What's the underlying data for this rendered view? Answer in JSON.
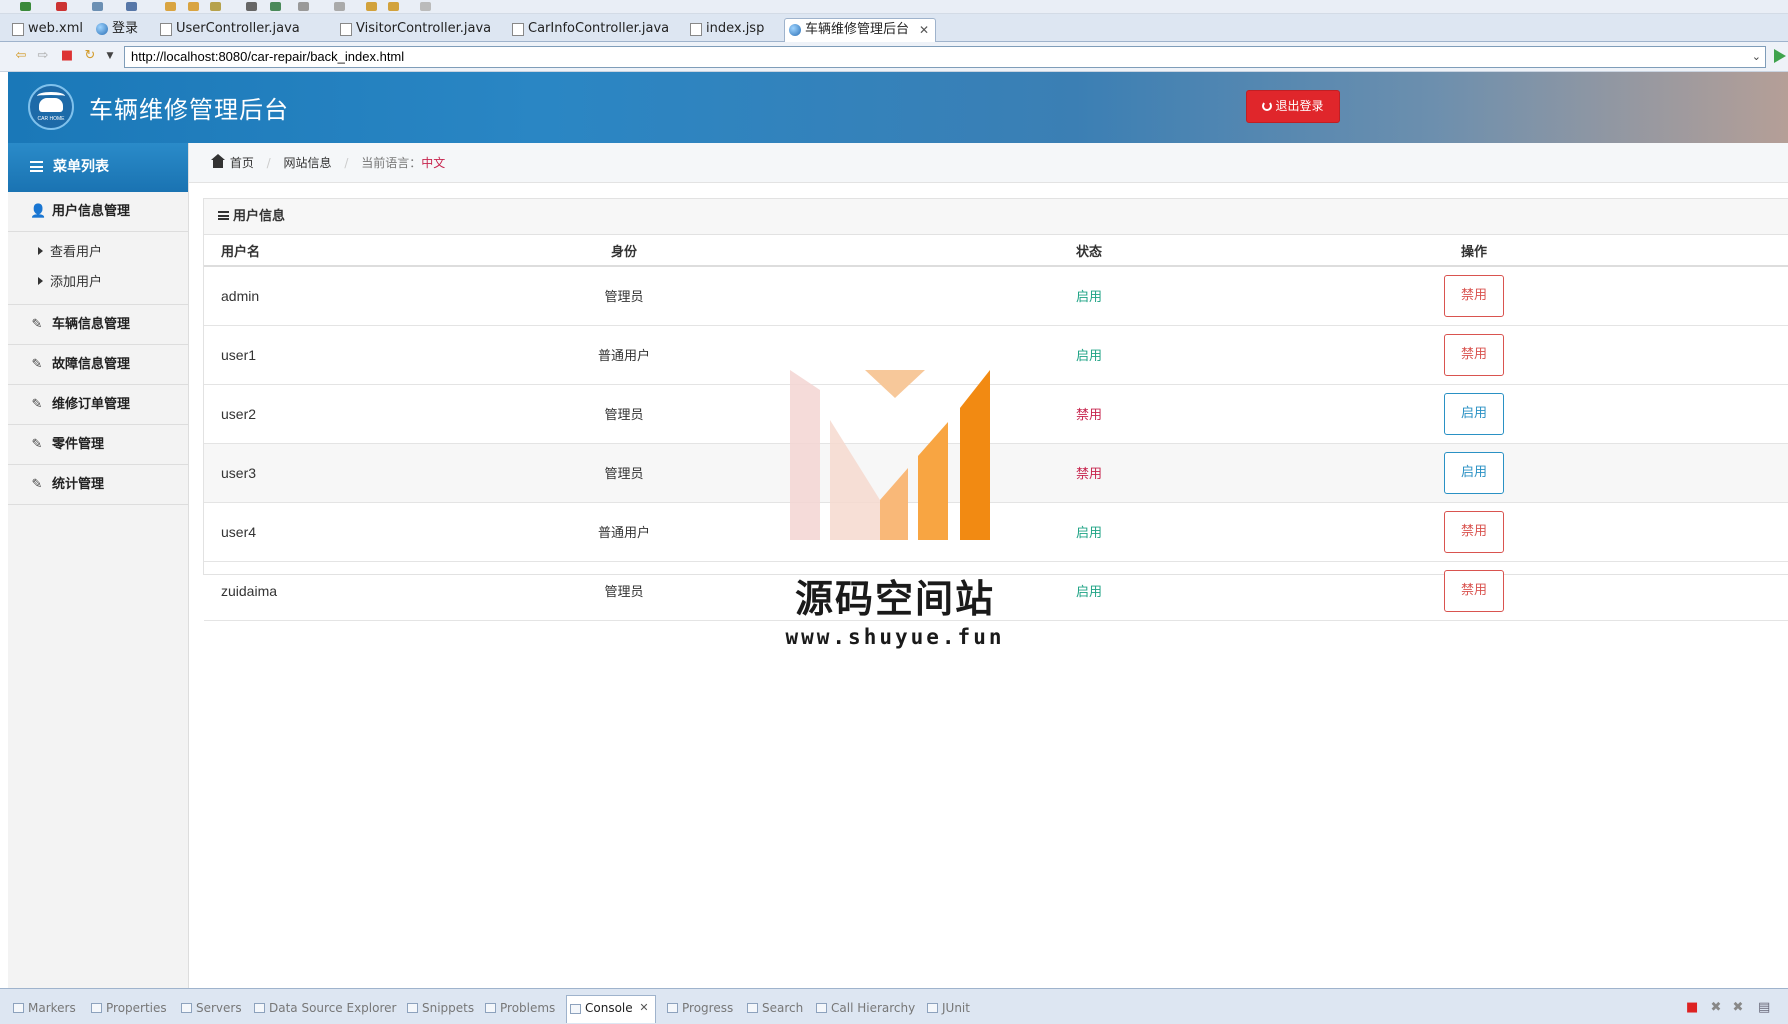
{
  "editor_tabs": [
    {
      "label": "web.xml",
      "type": "file"
    },
    {
      "label": "登录",
      "type": "web"
    },
    {
      "label": "UserController.java",
      "type": "file"
    },
    {
      "label": "VisitorController.java",
      "type": "file"
    },
    {
      "label": "CarInfoController.java",
      "type": "file"
    },
    {
      "label": "index.jsp",
      "type": "file"
    },
    {
      "label": "车辆维修管理后台",
      "type": "web",
      "active": true
    }
  ],
  "browser": {
    "url": "http://localhost:8080/car-repair/back_index.html"
  },
  "header": {
    "logo_text": "CAR HOME",
    "title": "车辆维修管理后台",
    "logout_label": "退出登录"
  },
  "sidebar": {
    "head": "菜单列表",
    "groups": [
      {
        "label": "用户信息管理",
        "icon": "user-icon",
        "sub": [
          "查看用户",
          "添加用户"
        ]
      },
      {
        "label": "车辆信息管理",
        "icon": "edit-icon"
      },
      {
        "label": "故障信息管理",
        "icon": "edit-icon"
      },
      {
        "label": "维修订单管理",
        "icon": "edit-icon"
      },
      {
        "label": "零件管理",
        "icon": "edit-icon"
      },
      {
        "label": "统计管理",
        "icon": "edit-icon"
      }
    ]
  },
  "breadcrumb": {
    "home": "首页",
    "site_info": "网站信息",
    "lang_label": "当前语言：",
    "lang_value": "中文"
  },
  "panel": {
    "title": "用户信息",
    "columns": [
      "用户名",
      "身份",
      "状态",
      "操作"
    ],
    "rows": [
      {
        "username": "admin",
        "role": "管理员",
        "status": "启用",
        "action": "禁用",
        "enabled": true
      },
      {
        "username": "user1",
        "role": "普通用户",
        "status": "启用",
        "action": "禁用",
        "enabled": true
      },
      {
        "username": "user2",
        "role": "管理员",
        "status": "禁用",
        "action": "启用",
        "enabled": false
      },
      {
        "username": "user3",
        "role": "管理员",
        "status": "禁用",
        "action": "启用",
        "enabled": false
      },
      {
        "username": "user4",
        "role": "普通用户",
        "status": "启用",
        "action": "禁用",
        "enabled": true
      },
      {
        "username": "zuidaima",
        "role": "管理员",
        "status": "启用",
        "action": "禁用",
        "enabled": true
      }
    ]
  },
  "watermark": {
    "title": "源码空间站",
    "url": "www.shuyue.fun"
  },
  "views": [
    {
      "label": "Markers"
    },
    {
      "label": "Properties"
    },
    {
      "label": "Servers"
    },
    {
      "label": "Data Source Explorer"
    },
    {
      "label": "Snippets"
    },
    {
      "label": "Problems"
    },
    {
      "label": "Console",
      "active": true
    },
    {
      "label": "Progress"
    },
    {
      "label": "Search"
    },
    {
      "label": "Call Hierarchy"
    },
    {
      "label": "JUnit"
    }
  ],
  "colors": {
    "header_blue": "#1a78b8",
    "logout_red": "#e0262b",
    "status_enabled": "#1fa385",
    "status_disabled": "#c7254e",
    "btn_danger": "#d9534f",
    "btn_info": "#2a91c4"
  }
}
